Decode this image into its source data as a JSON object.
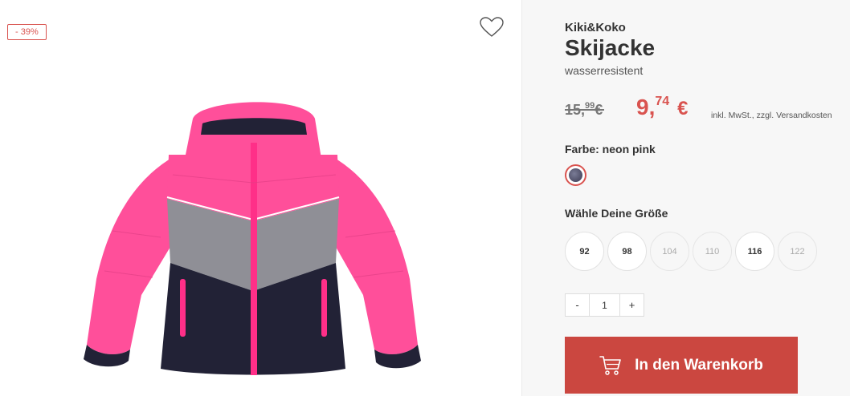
{
  "product": {
    "discount_badge": "- 39%",
    "brand": "Kiki&Koko",
    "title": "Skijacke",
    "subtitle": "wasserresistent",
    "image_alt": "Skijacke neon pink"
  },
  "price": {
    "old_main": "15,",
    "old_cents": "99",
    "old_currency": "€",
    "new_main": "9,",
    "new_cents": "74",
    "new_currency": "€",
    "tax_note": "inkl. MwSt., zzgl. Versandkosten"
  },
  "color": {
    "label": "Farbe: neon pink",
    "selected": "neon pink"
  },
  "sizes": {
    "label": "Wähle Deine Größe",
    "options": [
      {
        "value": "92",
        "available": true
      },
      {
        "value": "98",
        "available": true
      },
      {
        "value": "104",
        "available": false
      },
      {
        "value": "110",
        "available": false
      },
      {
        "value": "116",
        "available": true
      },
      {
        "value": "122",
        "available": false
      }
    ]
  },
  "quantity": {
    "minus": "-",
    "value": "1",
    "plus": "+"
  },
  "cart": {
    "label": "In den Warenkorb",
    "icon": "cart-icon"
  },
  "colors": {
    "accent": "#cb4740",
    "sale": "#d9534f",
    "jacket_pink": "#ff4f9a",
    "jacket_navy": "#222236",
    "jacket_grey": "#8f8f96"
  }
}
